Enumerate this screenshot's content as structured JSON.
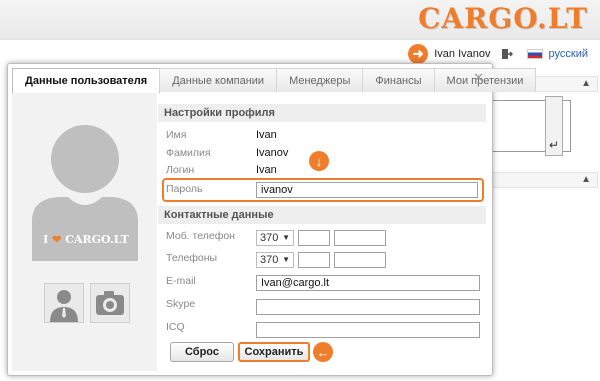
{
  "brand": "CARGO.LT",
  "user": {
    "name": "Ivan Ivanov",
    "language": "русский"
  },
  "tabs": [
    {
      "label": "Данные пользователя",
      "active": true
    },
    {
      "label": "Данные компании",
      "active": false
    },
    {
      "label": "Менеджеры",
      "active": false
    },
    {
      "label": "Финансы",
      "active": false
    },
    {
      "label": "Мои претензии",
      "active": false
    }
  ],
  "avatar": {
    "slogan_prefix": "I",
    "slogan_suffix": "CARGO.LT"
  },
  "profile": {
    "heading": "Настройки профиля",
    "first_name_label": "Имя",
    "first_name": "Ivan",
    "last_name_label": "Фамилия",
    "last_name": "Ivanov",
    "login_label": "Логин",
    "login": "Ivan",
    "password_label": "Пароль",
    "password": "ivanov"
  },
  "contacts": {
    "heading": "Контактные данные",
    "mobile_label": "Моб. телефон",
    "mobile_code": "370",
    "phones_label": "Телефоны",
    "phones_code": "370",
    "email_label": "E-mail",
    "email": "Ivan@cargo.lt",
    "skype_label": "Skype",
    "skype": "",
    "icq_label": "ICQ",
    "icq": ""
  },
  "buttons": {
    "reset": "Сброс",
    "save": "Сохранить"
  },
  "colors": {
    "accent": "#f07d2b",
    "link": "#2a5fb5"
  }
}
